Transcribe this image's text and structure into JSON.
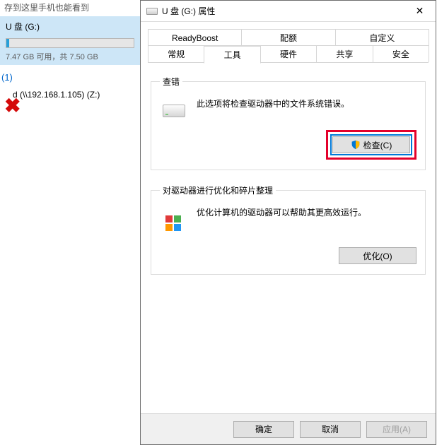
{
  "left": {
    "cutoff_text": "存到这里手机也能看到",
    "usb": {
      "name": "U 盘 (G:)",
      "capacity": "7.47 GB 可用，共 7.50 GB"
    },
    "section_count_label": "(1)",
    "net_drive_name": "d (\\\\192.168.1.105) (Z:)"
  },
  "dialog": {
    "title": "U 盘 (G:) 属性",
    "tabs_back": [
      "ReadyBoost",
      "配额",
      "自定义"
    ],
    "tabs_front": [
      "常规",
      "工具",
      "硬件",
      "共享",
      "安全"
    ],
    "active_tab": "工具",
    "check": {
      "legend": "查错",
      "desc": "此选项将检查驱动器中的文件系统错误。",
      "button": "检查(C)"
    },
    "optimize": {
      "legend": "对驱动器进行优化和碎片整理",
      "desc": "优化计算机的驱动器可以帮助其更高效运行。",
      "button": "优化(O)"
    },
    "footer": {
      "ok": "确定",
      "cancel": "取消",
      "apply": "应用(A)"
    }
  }
}
